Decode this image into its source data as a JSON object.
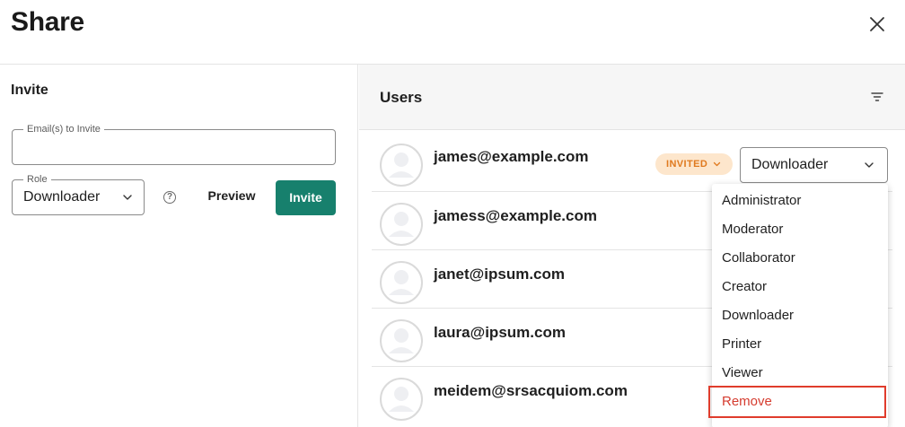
{
  "dialog": {
    "title": "Share"
  },
  "invite": {
    "heading": "Invite",
    "email_label": "Email(s) to Invite",
    "email_value": "",
    "role_label": "Role",
    "role_value": "Downloader",
    "preview_label": "Preview",
    "invite_label": "Invite",
    "help_glyph": "?"
  },
  "users": {
    "heading": "Users",
    "rows": [
      {
        "email": "james@example.com",
        "badge": "INVITED",
        "role": "Downloader"
      },
      {
        "email": "jamess@example.com"
      },
      {
        "email": "janet@ipsum.com"
      },
      {
        "email": "laura@ipsum.com"
      },
      {
        "email": "meidem@srsacquiom.com"
      }
    ]
  },
  "role_menu": {
    "items": [
      "Administrator",
      "Moderator",
      "Collaborator",
      "Creator",
      "Downloader",
      "Printer",
      "Viewer",
      "Remove"
    ]
  },
  "colors": {
    "primary_button": "#17806d",
    "invited_badge_bg": "#fde6cc",
    "invited_badge_text": "#e07a1f",
    "remove_text": "#d53c2f"
  },
  "icons": [
    "close-icon",
    "chevron-down-icon",
    "help-icon",
    "filter-icon",
    "avatar-icon"
  ]
}
